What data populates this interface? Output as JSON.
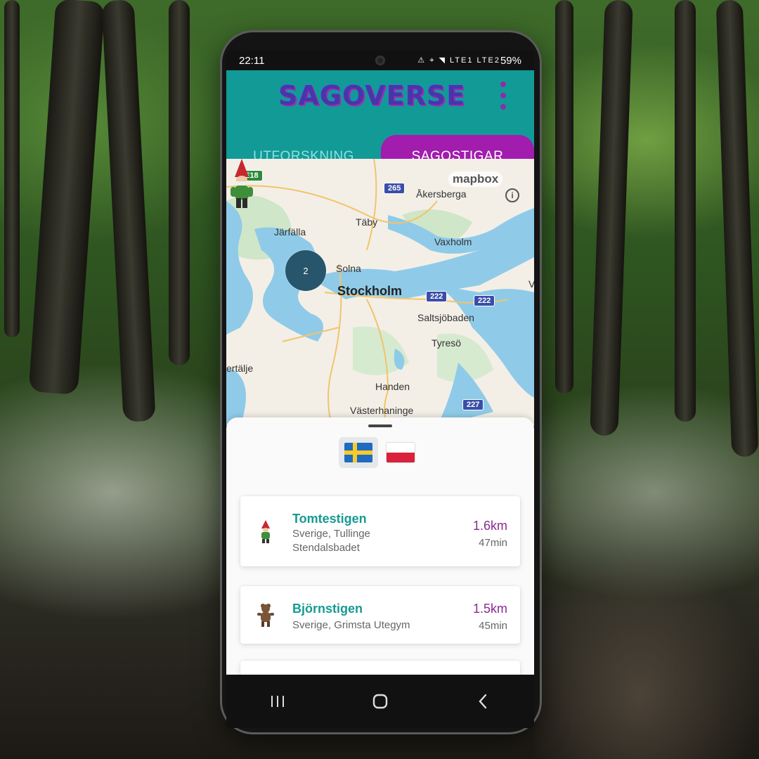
{
  "status_bar": {
    "time": "22:11",
    "icons": "⚠ ⌖ ◥ LTE1 LTE2",
    "battery": "59%"
  },
  "app": {
    "logo": "SAGOVERSE",
    "menu_icon": "more-vert-icon"
  },
  "tabs": [
    {
      "label": "UTFORSKNING",
      "active": false
    },
    {
      "label": "SAGOSTIGAR",
      "active": true
    }
  ],
  "map": {
    "attribution": "mapbox",
    "cluster_count": "2",
    "labels": {
      "akersberga": "Åkersberga",
      "taby": "Täby",
      "jarfalla": "Järfälla",
      "vaxholm": "Vaxholm",
      "solna": "Solna",
      "stockholm": "Stockholm",
      "saltsjobaden": "Saltsjöbaden",
      "tyreso": "Tyresö",
      "sodertalje": "ertälje",
      "handen": "Handen",
      "vasterhaninge": "Västerhaninge",
      "v": "V"
    },
    "shields": {
      "e18": "E18",
      "r265": "265",
      "r222a": "222",
      "r222b": "222",
      "r227": "227"
    }
  },
  "languages": [
    {
      "name": "Svenska",
      "icon": "sweden-flag-icon",
      "selected": true
    },
    {
      "name": "Polski",
      "icon": "poland-flag-icon",
      "selected": false
    }
  ],
  "trails": [
    {
      "name": "Tomtestigen",
      "location": "Sverige, Tullinge",
      "location2": "Stendalsbadet",
      "distance": "1.6km",
      "duration": "47min",
      "icon": "gnome-icon"
    },
    {
      "name": "Björnstigen",
      "location": "Sverige, Grimsta Utegym",
      "distance": "1.5km",
      "duration": "45min",
      "icon": "bear-icon"
    }
  ],
  "nav": {
    "recents": "|||",
    "home": "▢",
    "back": "‹"
  },
  "colors": {
    "teal": "#129a97",
    "purple": "#a21cae",
    "title_teal": "#169a92",
    "distance_purple": "#8a2a90",
    "cluster": "#27556b"
  }
}
